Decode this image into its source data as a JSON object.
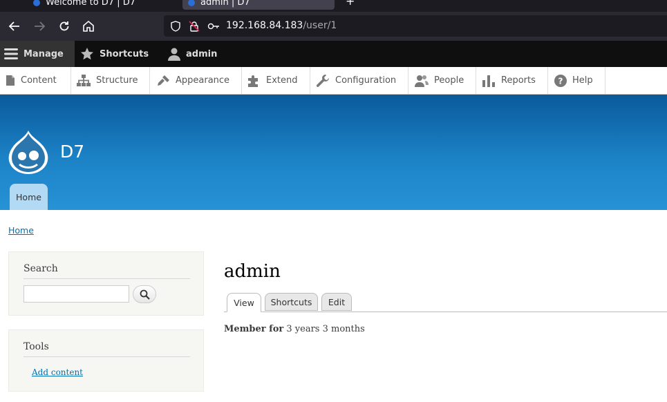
{
  "browser": {
    "tabs": [
      {
        "label": "Welcome to D7 | D7"
      },
      {
        "label": "admin | D7"
      }
    ],
    "new_tab": "+",
    "url_host": "192.168.84.183",
    "url_path": "/user/1"
  },
  "toolbar": {
    "manage": "Manage",
    "shortcuts": "Shortcuts",
    "user": "admin"
  },
  "tray": {
    "items": [
      {
        "label": "Content"
      },
      {
        "label": "Structure"
      },
      {
        "label": "Appearance"
      },
      {
        "label": "Extend"
      },
      {
        "label": "Configuration"
      },
      {
        "label": "People"
      },
      {
        "label": "Reports"
      },
      {
        "label": "Help"
      }
    ]
  },
  "header": {
    "site_name": "D7",
    "home_tab": "Home"
  },
  "breadcrumb": "Home",
  "sidebar": {
    "search_title": "Search",
    "search_value": "",
    "tools_title": "Tools",
    "add_content": "Add content"
  },
  "main": {
    "title": "admin",
    "tabs": [
      {
        "label": "View"
      },
      {
        "label": "Shortcuts"
      },
      {
        "label": "Edit"
      }
    ],
    "member_label": "Member for",
    "member_value": "3 years 3 months"
  },
  "colors": {
    "header_top": "#0a5a9b",
    "header_bottom": "#2792d6",
    "link": "#0071b3"
  }
}
